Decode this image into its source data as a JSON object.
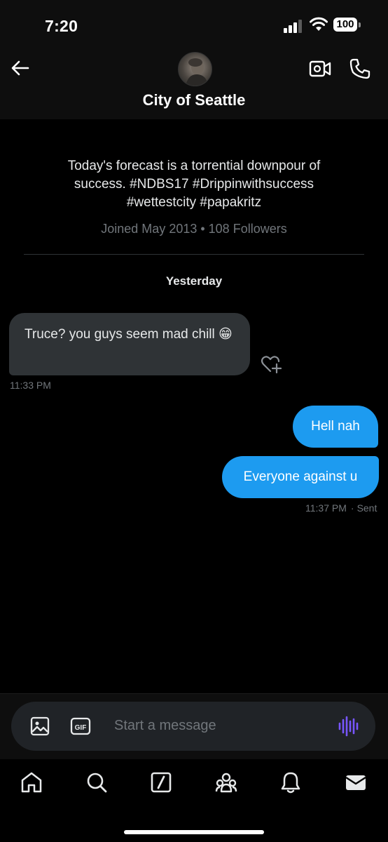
{
  "status": {
    "time": "7:20",
    "battery": "100"
  },
  "header": {
    "title": "City of Seattle"
  },
  "profile": {
    "bio": "Today's forecast is a torrential downpour of success. #NDBS17 #Drippinwithsuccess #wettestcity #papakritz",
    "meta": "Joined May 2013 • 108 Followers"
  },
  "conversation": {
    "day_label": "Yesterday",
    "messages": [
      {
        "direction": "in",
        "text": "Truce? you guys seem mad chill 😁",
        "time": "11:33 PM"
      },
      {
        "direction": "out",
        "text": "Hell nah"
      },
      {
        "direction": "out",
        "text": "Everyone against u",
        "time": "11:37 PM",
        "status": "Sent"
      }
    ]
  },
  "composer": {
    "placeholder": "Start a message",
    "gif_label": "GIF"
  },
  "icons": {
    "back": "arrow-left-icon",
    "video": "video-call-icon",
    "call": "phone-icon",
    "image": "image-icon",
    "gif": "gif-icon",
    "voice": "voice-waveform-icon",
    "tabs": [
      "home-icon",
      "search-icon",
      "grok-icon",
      "communities-icon",
      "notifications-icon",
      "messages-icon"
    ]
  },
  "colors": {
    "accent": "#1d9bf0",
    "incoming_bubble": "#2f3336",
    "muted_text": "#71767b",
    "voice_icon": "#7856ff"
  }
}
